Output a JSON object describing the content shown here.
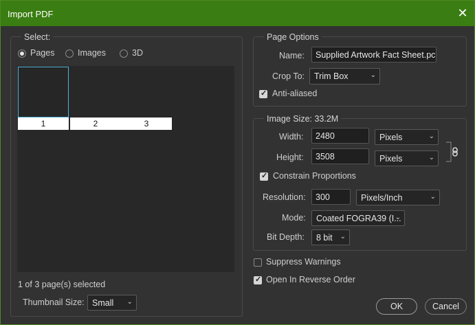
{
  "window": {
    "title": "Import PDF"
  },
  "select": {
    "legend": "Select:",
    "options": [
      {
        "label": "Pages",
        "selected": true
      },
      {
        "label": "Images",
        "selected": false
      },
      {
        "label": "3D",
        "selected": false
      }
    ],
    "thumbnails": [
      "1",
      "2",
      "3"
    ],
    "status": "1 of 3 page(s) selected",
    "thumb_size_label": "Thumbnail Size:",
    "thumb_size_value": "Small"
  },
  "page_options": {
    "legend": "Page Options",
    "name_label": "Name:",
    "name_value": "Supplied Artwork Fact Sheet.pc",
    "crop_label": "Crop To:",
    "crop_value": "Trim Box",
    "anti_aliased_label": "Anti-aliased",
    "anti_aliased_checked": true
  },
  "image_size": {
    "legend": "Image Size: 33.2M",
    "width_label": "Width:",
    "width_value": "2480",
    "width_unit": "Pixels",
    "height_label": "Height:",
    "height_value": "3508",
    "height_unit": "Pixels",
    "constrain_label": "Constrain Proportions",
    "constrain_checked": true,
    "resolution_label": "Resolution:",
    "resolution_value": "300",
    "resolution_unit": "Pixels/Inch",
    "mode_label": "Mode:",
    "mode_value": "Coated FOGRA39 (I...",
    "bitdepth_label": "Bit Depth:",
    "bitdepth_value": "8 bit"
  },
  "extra": {
    "suppress_label": "Suppress Warnings",
    "suppress_checked": false,
    "reverse_label": "Open In Reverse Order",
    "reverse_checked": true
  },
  "buttons": {
    "ok": "OK",
    "cancel": "Cancel"
  },
  "colors": {
    "titlebar": "#3a7d12",
    "background": "#323232",
    "selection": "#4fb3d9"
  }
}
